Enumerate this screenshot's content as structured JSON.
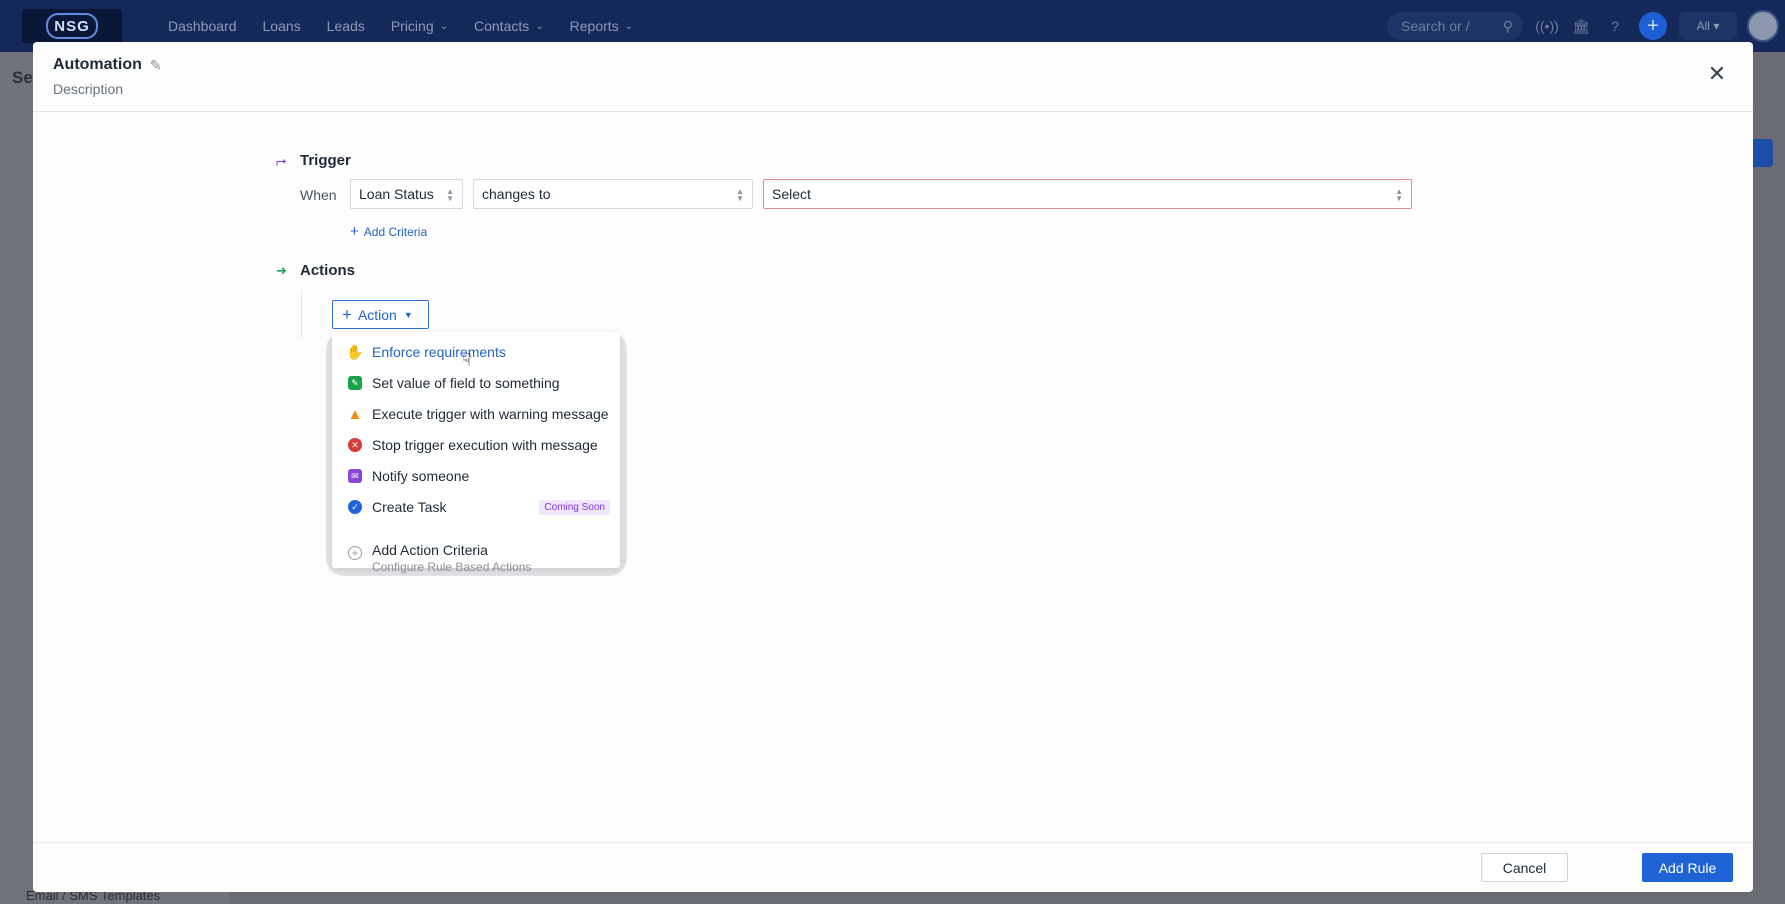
{
  "topnav": {
    "logo_text": "NSG",
    "items": [
      {
        "label": "Dashboard",
        "has_menu": false
      },
      {
        "label": "Loans",
        "has_menu": false
      },
      {
        "label": "Leads",
        "has_menu": false
      },
      {
        "label": "Pricing",
        "has_menu": true
      },
      {
        "label": "Contacts",
        "has_menu": true
      },
      {
        "label": "Reports",
        "has_menu": true
      }
    ],
    "search_placeholder": "Search or /",
    "scope_label": "All"
  },
  "background": {
    "page_title_fragment": "Se",
    "footer_item": "Email / SMS Templates"
  },
  "modal": {
    "title": "Automation",
    "description": "Description",
    "trigger": {
      "heading": "Trigger",
      "when_label": "When",
      "field_value": "Loan Status",
      "operator_value": "changes to",
      "value_placeholder": "Select",
      "add_criteria_label": "Add Criteria"
    },
    "actions": {
      "heading": "Actions",
      "action_button_label": "Action"
    },
    "dropdown": {
      "items": [
        {
          "label": "Enforce requirements",
          "icon": "hand-icon",
          "color": "#2563c9"
        },
        {
          "label": "Set value of field to something",
          "icon": "set-field-icon",
          "color": "#16a34a"
        },
        {
          "label": "Execute trigger with warning message",
          "icon": "warning-icon",
          "color": "#f08a12"
        },
        {
          "label": "Stop trigger execution with message",
          "icon": "stop-icon",
          "color": "#d93a3a"
        },
        {
          "label": "Notify someone",
          "icon": "mail-icon",
          "color": "#8b46d6"
        },
        {
          "label": "Create Task",
          "icon": "check-circle-icon",
          "color": "#1f63d6",
          "badge": "Coming Soon"
        }
      ],
      "criteria_title": "Add Action Criteria",
      "criteria_subtitle": "Configure Rule Based Actions"
    },
    "footer": {
      "cancel_label": "Cancel",
      "submit_label": "Add Rule"
    }
  }
}
